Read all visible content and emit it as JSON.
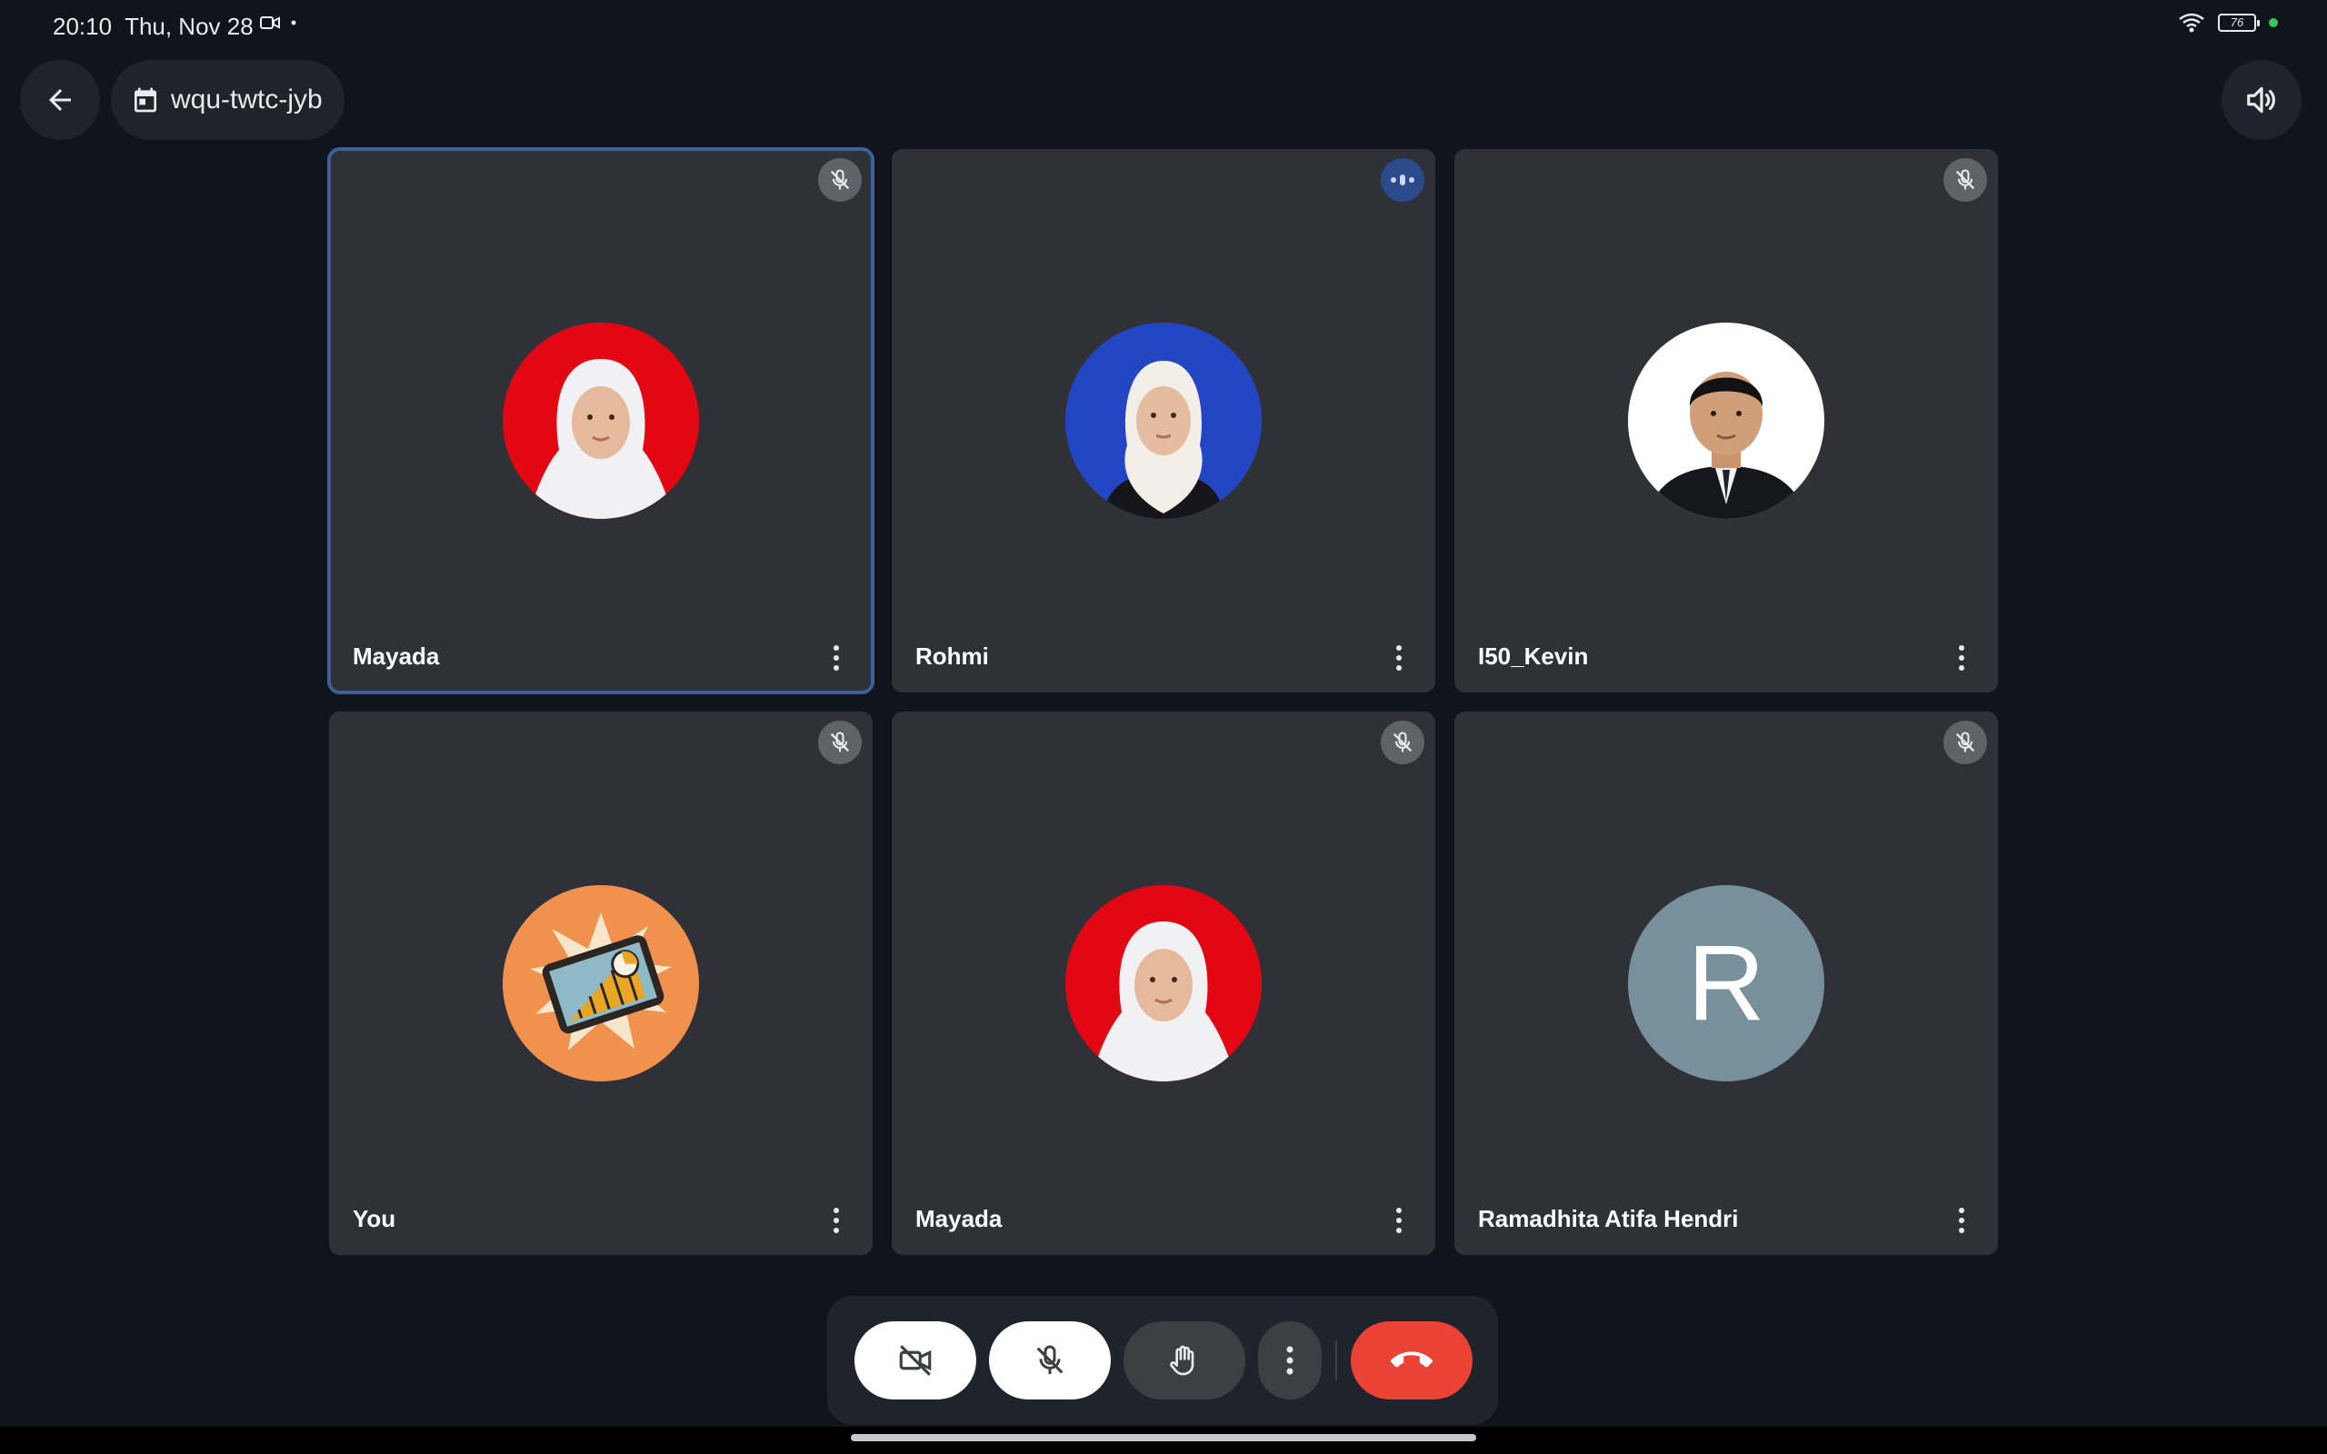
{
  "status_bar": {
    "time": "20:10",
    "date": "Thu, Nov 28",
    "battery_level": "76",
    "icons": [
      "video-recording-icon",
      "dot-icon",
      "wifi-icon",
      "battery-icon",
      "privacy-dot-icon"
    ]
  },
  "header": {
    "meeting_code": "wqu-twtc-jyb",
    "icons": [
      "back-arrow-icon",
      "calendar-icon",
      "speaker-icon"
    ]
  },
  "participants": [
    {
      "name": "Mayada",
      "status": "muted",
      "active": true,
      "avatar": "photo-red-background"
    },
    {
      "name": "Rohmi",
      "status": "speaking",
      "active": false,
      "avatar": "photo-blue-background"
    },
    {
      "name": "I50_Kevin",
      "status": "muted",
      "active": false,
      "avatar": "photo-white-background"
    },
    {
      "name": "You",
      "status": "muted",
      "active": false,
      "avatar": "illustration-orange-background"
    },
    {
      "name": "Mayada",
      "status": "muted",
      "active": false,
      "avatar": "photo-red-background"
    },
    {
      "name": "Ramadhita Atifa Hendri",
      "status": "muted",
      "active": false,
      "avatar": "letter",
      "avatar_letter": "R"
    }
  ],
  "controls": {
    "buttons": [
      "camera-off-icon",
      "mic-off-icon",
      "raise-hand-icon",
      "more-vert-icon",
      "end-call-icon"
    ]
  },
  "colors": {
    "background": "#10141c",
    "tile": "#303136",
    "active_border": "#3f5f99",
    "end_call": "#ea4335",
    "letter_avatar": "#78909c"
  }
}
